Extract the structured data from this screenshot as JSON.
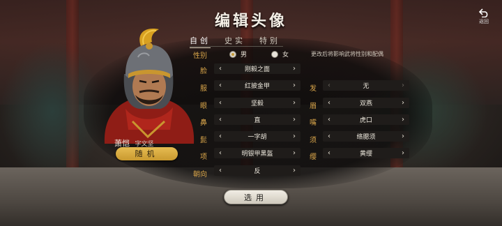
{
  "title": "编辑头像",
  "back": {
    "label": "返回"
  },
  "character": {
    "name": "萧恺",
    "style_name": "字文坚"
  },
  "random_label": "随机",
  "tabs": [
    {
      "label": "自创",
      "active": true
    },
    {
      "label": "史实",
      "active": false
    },
    {
      "label": "特别",
      "active": false
    }
  ],
  "gender": {
    "label": "性别",
    "options": [
      {
        "label": "男",
        "selected": true
      },
      {
        "label": "女",
        "selected": false
      }
    ],
    "note": "更改后将影响武将性别和配偶"
  },
  "left_column": [
    {
      "label": "脸",
      "value": "刚毅之面"
    },
    {
      "label": "服",
      "value": "红披金甲"
    },
    {
      "label": "眼",
      "value": "坚毅"
    },
    {
      "label": "鼻",
      "value": "直"
    },
    {
      "label": "髭",
      "value": "一字胡"
    },
    {
      "label": "项",
      "value": "明银甲黑盔"
    },
    {
      "label": "朝向",
      "value": "反"
    }
  ],
  "right_column": [
    {
      "label": "发",
      "value": "无",
      "disabled": true
    },
    {
      "label": "眉",
      "value": "双燕"
    },
    {
      "label": "嘴",
      "value": "虎口"
    },
    {
      "label": "须",
      "value": "络腮须"
    },
    {
      "label": "缨",
      "value": "黄缨"
    }
  ],
  "apply_label": "选用",
  "colors": {
    "accent_gold": "#d9a54a",
    "button_gold": "#e6bc52"
  }
}
